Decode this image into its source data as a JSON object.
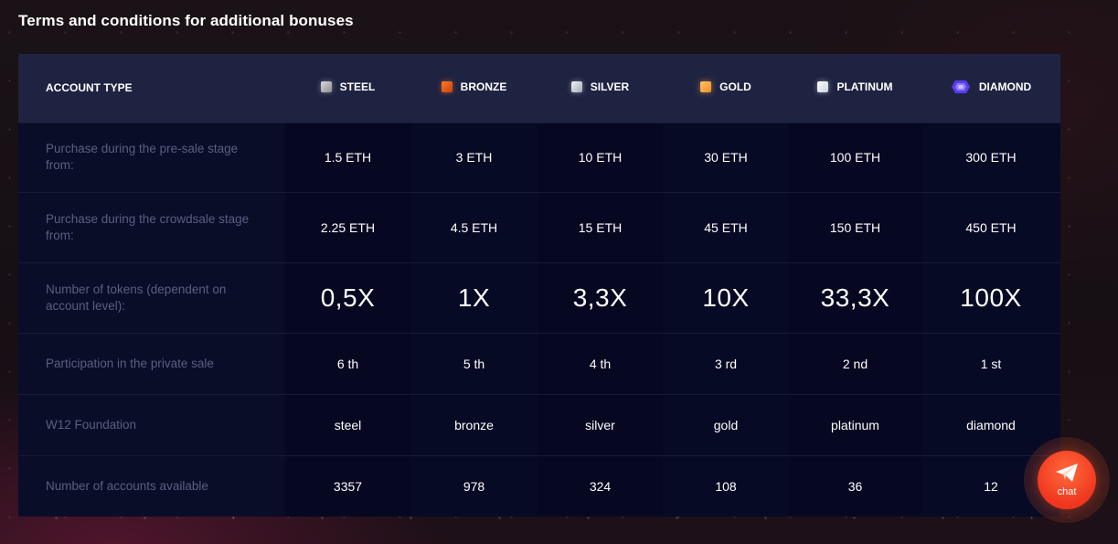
{
  "page": {
    "title": "Terms and conditions for additional bonuses"
  },
  "table": {
    "header": {
      "account_type": "ACCOUNT TYPE",
      "tiers": [
        {
          "label": "STEEL",
          "icon": "steel-chip-icon",
          "color": "#b9b9be"
        },
        {
          "label": "BRONZE",
          "icon": "bronze-chip-icon",
          "color": "#e8601c"
        },
        {
          "label": "SILVER",
          "icon": "silver-chip-icon",
          "color": "#c9cfd6"
        },
        {
          "label": "GOLD",
          "icon": "gold-chip-icon",
          "color": "#f9a93f"
        },
        {
          "label": "PLATINUM",
          "icon": "platinum-chip-icon",
          "color": "#e6ebf1"
        },
        {
          "label": "DIAMOND",
          "icon": "diamond-gem-icon",
          "color": "#6a4cff"
        }
      ]
    },
    "rows": [
      {
        "label": "Purchase during the pre-sale stage from:",
        "values": [
          "1.5 ETH",
          "3 ETH",
          "10 ETH",
          "30 ETH",
          "100 ETH",
          "300 ETH"
        ]
      },
      {
        "label": "Purchase during the crowdsale stage from:",
        "values": [
          "2.25 ETH",
          "4.5 ETH",
          "15 ETH",
          "45 ETH",
          "150 ETH",
          "450 ETH"
        ]
      },
      {
        "label": "Number of tokens (dependent on account level):",
        "values": [
          "0,5X",
          "1X",
          "3,3X",
          "10X",
          "33,3X",
          "100X"
        ]
      },
      {
        "label": "Participation in the private sale",
        "values": [
          "6 th",
          "5 th",
          "4 th",
          "3 rd",
          "2 nd",
          "1 st"
        ]
      },
      {
        "label": "W12 Foundation",
        "values": [
          "steel",
          "bronze",
          "silver",
          "gold",
          "platinum",
          "diamond"
        ]
      },
      {
        "label": "Number of accounts available",
        "values": [
          "3357",
          "978",
          "324",
          "108",
          "36",
          "12"
        ]
      }
    ]
  },
  "chat": {
    "label": "chat",
    "icon": "paper-plane-icon",
    "color": "#f0361f"
  }
}
